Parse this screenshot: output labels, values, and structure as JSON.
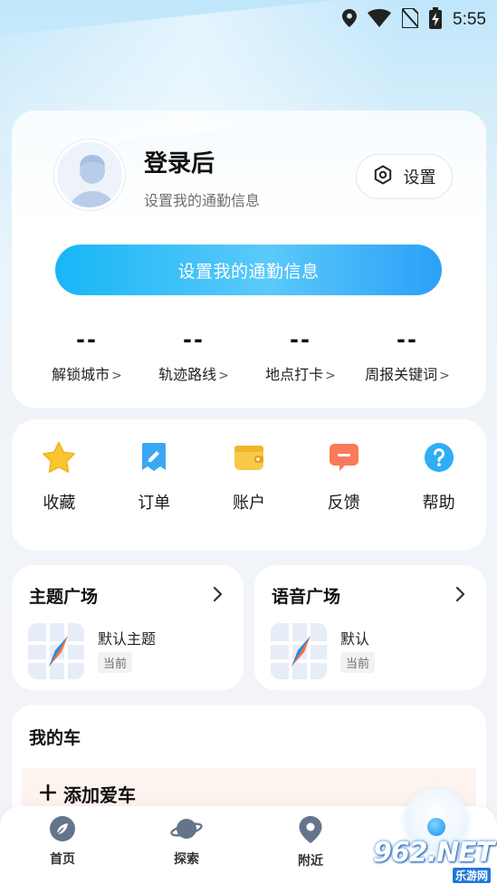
{
  "status_bar": {
    "time": "5:55",
    "icons": [
      "location-icon",
      "wifi-icon",
      "no-sim-icon",
      "battery-charging-icon"
    ]
  },
  "profile": {
    "title": "登录后",
    "subtitle": "设置我的通勤信息",
    "settings_label": "设置",
    "commute_button": "设置我的通勤信息",
    "stats": [
      {
        "value": "--",
        "label": "解锁城市"
      },
      {
        "value": "--",
        "label": "轨迹路线"
      },
      {
        "value": "--",
        "label": "地点打卡"
      },
      {
        "value": "--",
        "label": "周报关键词"
      }
    ],
    "chevron": ">"
  },
  "quick_actions": [
    {
      "label": "收藏",
      "icon": "star-icon",
      "color": "#f9c531"
    },
    {
      "label": "订单",
      "icon": "order-icon",
      "color": "#3aa7f5"
    },
    {
      "label": "账户",
      "icon": "wallet-icon",
      "color": "#f7c948"
    },
    {
      "label": "反馈",
      "icon": "feedback-icon",
      "color": "#fb7a5c"
    },
    {
      "label": "帮助",
      "icon": "help-icon",
      "color": "#2eaef5"
    }
  ],
  "theme_plaza": {
    "title": "主题广场",
    "item_name": "默认主题",
    "badge": "当前"
  },
  "voice_plaza": {
    "title": "语音广场",
    "item_name": "默认",
    "badge": "当前"
  },
  "my_car": {
    "title": "我的车",
    "add_label": "添加爱车"
  },
  "bottom_nav": [
    {
      "label": "首页",
      "icon": "leaf-icon"
    },
    {
      "label": "探索",
      "icon": "planet-icon"
    },
    {
      "label": "附近",
      "icon": "location-pin-icon"
    }
  ],
  "watermark": {
    "text": "962.NET",
    "sub": "乐游网"
  },
  "colors": {
    "accent": "#18b6f6",
    "card_bg": "#ffffff",
    "add_car_bg": "#fdf3ef"
  }
}
